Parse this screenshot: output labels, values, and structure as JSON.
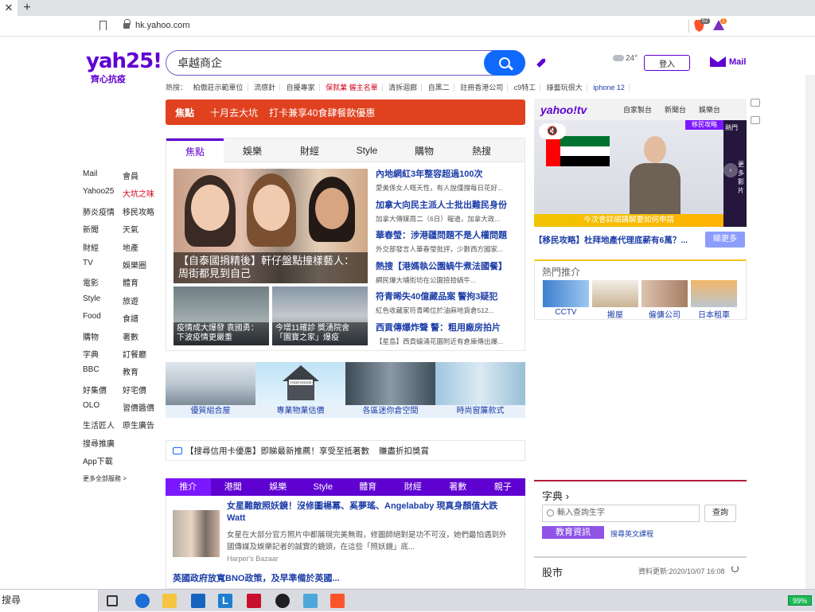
{
  "browser": {
    "new_tab": "+",
    "url": "hk.yahoo.com",
    "brave_badge": "62",
    "rewards_badge": "1"
  },
  "header": {
    "logo_main": "yah25!",
    "logo_sub": "齊心抗疫",
    "search_value": "卓越商企",
    "weather_temp": "24°",
    "login": "登入",
    "mail": "Mail"
  },
  "trending": {
    "label": "熱搜：",
    "items": [
      "柏傲莊示範單位",
      "流感針",
      "自擾專家",
      "保就業 僱主名單",
      "清拆迴廊",
      "自黑二",
      "註冊香港公司",
      "c9特工",
      "綠藝玩很大",
      "iphone 12"
    ]
  },
  "leftnav": {
    "rows": [
      [
        "Mail",
        "會員"
      ],
      [
        "Yahoo25",
        "大坑之味"
      ],
      [
        "肺炎疫情",
        "移民攻略"
      ],
      [
        "新聞",
        "天氣"
      ],
      [
        "財經",
        "地產"
      ],
      [
        "TV",
        "娛樂圈"
      ],
      [
        "電影",
        "體育"
      ],
      [
        "Style",
        "旅遊"
      ],
      [
        "Food",
        "食譜"
      ],
      [
        "購物",
        "著數"
      ],
      [
        "字典",
        "訂餐廳"
      ],
      [
        "BBC",
        "教育"
      ],
      [
        "好集價",
        "好宅價"
      ],
      [
        "OLO",
        "習價醬價"
      ],
      [
        "生活匠人",
        "原生廣告"
      ],
      [
        "搜尋推廣",
        ""
      ],
      [
        "App下載",
        ""
      ]
    ],
    "more": "更多全部服務 >"
  },
  "focus": {
    "label": "焦點",
    "items": [
      "十月去大坑",
      "打卡兼享40食肆餐飲優惠"
    ]
  },
  "news": {
    "tabs": [
      "焦點",
      "娛樂",
      "財經",
      "Style",
      "購物",
      "熱搜"
    ],
    "hero_caption": "【自泰國捐精後】軒仔盤點撞樣藝人：周街都見到自己",
    "thumb1_caption": "疫情成大爆發 袁國勇：下波疫情更嚴重",
    "thumb2_caption": "今增11確診 獎湧院舍「園寶之家」爆疫",
    "headlines": [
      {
        "title": "內地網紅3年整容超過100次",
        "sub": "愛美係女人嘅天性，有人說僅撐每日花好..."
      },
      {
        "title": "加拿大向民主派人士批出難民身份",
        "sub": "加拿大傳媒周二（6日）報道，加拿大政..."
      },
      {
        "title": "華春瑩：涉港疆問題不是人權問題",
        "sub": "外交部發言人華春瑩批評，少數西方國家..."
      },
      {
        "title": "熱搜【港媽執公園蝸牛煮法國餐】",
        "sub": "網民爆大埔街坊在公園撿拾蝸牛..."
      },
      {
        "title": "符青晞失40億藏品案 警拘3疑犯",
        "sub": "紅色收藏家符青晞位於油麻地貨倉512..."
      },
      {
        "title": "西貢傳爆炸聲 警：粗用廠房拍片",
        "sub": "【星島】西貢蠔涌花園附近有倉庫傳出爆..."
      }
    ]
  },
  "promo": {
    "items": [
      "優質組合屋",
      "專業物業估價",
      "各區迷你倉空間",
      "時尚窗簾款式"
    ],
    "house_sign": "YOUR HOUSE"
  },
  "card_ad": {
    "text": "【搜尋信用卡優惠】即睇最新推薦！享受至抵著數",
    "link": "賺盡折扣獎賞"
  },
  "bottom": {
    "tabs": [
      "推介",
      "港聞",
      "娛樂",
      "Style",
      "體育",
      "財經",
      "著數",
      "親子"
    ],
    "title1": "女星難敵照妖鏡！沒修圖楊冪、奚夢瑤、Angelababy 現真身顏值大跌 Watt",
    "sub1": "女星在大部分官方照片中都展現完美無瑕，修圖師絕對是功不可沒，她們最怕遇到外國傳媒及娛樂記者的誠實的鏡頭，在這些「照妖鏡」底...",
    "source1": "Harper's Bazaar",
    "title2": "英國政府放寬BNO政策，及早準備於英國..."
  },
  "tv": {
    "logo": "yahoo!tv",
    "tabs": [
      "自家製台",
      "新聞台",
      "娛樂台"
    ],
    "video_caption": "今次會詳細講解要如何申請",
    "video_badge": "移民攻略",
    "mute": "🔇",
    "side_text": "熱門",
    "more_text": "更多影片",
    "title": "【移民攻略】杜拜地產代理底薪有6萬？...",
    "see_more": "睇更多"
  },
  "hot": {
    "heading": "熱門推介",
    "items": [
      "CCTV",
      "搬屋",
      "僱傭公司",
      "日本租車"
    ]
  },
  "dict": {
    "heading": "字典 ›",
    "placeholder": "輸入查詢生字",
    "button": "查詢",
    "edu": "教育資訊",
    "link": "搜尋英文課程"
  },
  "stock": {
    "heading": "股市",
    "updated": "資料更新:2020/10/07 16:08"
  },
  "taskbar": {
    "search": "搜尋",
    "l_label": "L",
    "battery": "99%"
  }
}
